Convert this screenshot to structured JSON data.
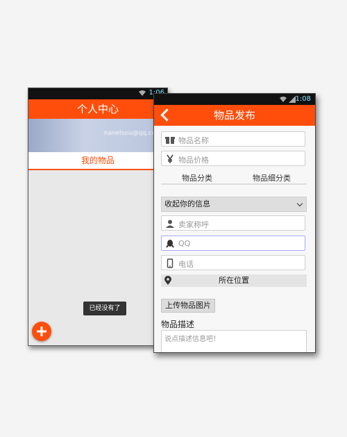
{
  "left_screen": {
    "status_time": "1:06",
    "title": "个人中心",
    "email": "nanelsou@qq.com",
    "tab_label": "我的物品",
    "toast": "已经没有了"
  },
  "right_screen": {
    "status_time": "1:08",
    "title": "物品发布",
    "item_name_placeholder": "物品名称",
    "item_price_placeholder": "物品价格",
    "category_label": "物品分类",
    "subcategory_label": "物品细分类",
    "collapse_select_label": "收起你的信息",
    "seller_name_placeholder": "卖家称呼",
    "qq_placeholder": "QQ",
    "phone_placeholder": "电话",
    "location_label": "所在位置",
    "upload_button": "上传物品图片",
    "description_label": "物品描述",
    "description_placeholder": "说点描述信息吧！"
  },
  "colors": {
    "accent": "#ff4e0b",
    "status_bar": "#111111"
  }
}
